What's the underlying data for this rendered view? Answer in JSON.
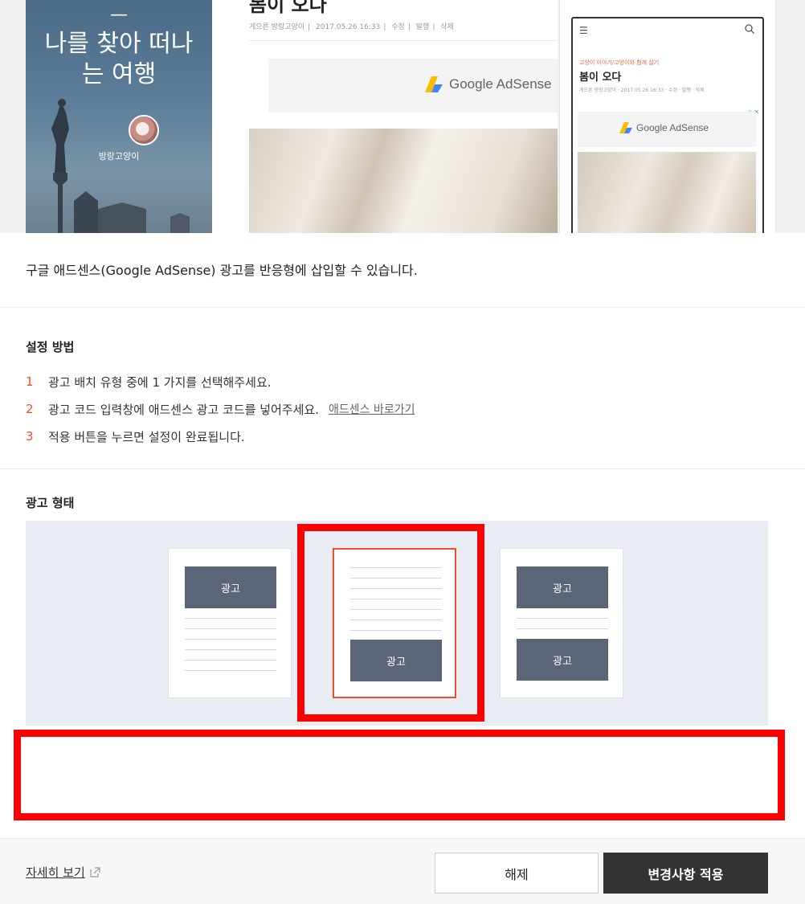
{
  "preview": {
    "cover_dash": "—",
    "cover_headline_line1": "나를 찾아 떠나",
    "cover_headline_line2": "는 여행",
    "cover_nickname": "방랑고양이",
    "article_title": "봄이 오다",
    "article_meta": [
      "게으른 방랑고양이",
      "2017.05.26 16:33",
      "수정",
      "발행",
      "삭제"
    ],
    "ad_brand": "Google AdSense",
    "mobile": {
      "category": "고양이 이야기/고양이와 함께 살기",
      "title": "봄이 오다",
      "meta": "게으른 방랑고양이 · 2017.05.26 16:33 · 수정 · 발행 · 삭제",
      "ad_brand": "Google AdSense"
    }
  },
  "description": "구글 애드센스(Google AdSense) 광고를 반응형에 삽입할 수 있습니다.",
  "setup": {
    "title": "설정 방법",
    "steps": [
      {
        "num": "1",
        "text": "광고 배치 유형 중에 1 가지를 선택해주세요."
      },
      {
        "num": "2",
        "text": "광고 코드 입력창에 애드센스 광고 코드를 넣어주세요.",
        "link": "애드센스 바로가기"
      },
      {
        "num": "3",
        "text": "적용 버튼을 누르면 설정이 완료됩니다."
      }
    ]
  },
  "ad_forms": {
    "title": "광고 형태",
    "ad_label": "광고",
    "options": [
      "top",
      "bottom",
      "top-and-bottom"
    ],
    "selected": "bottom"
  },
  "colors": {
    "accent": "#f04d2d",
    "ad_block": "#5a6577",
    "highlight": "#ff0000",
    "apply_button": "#333333"
  },
  "footer": {
    "more_link": "자세히 보기",
    "release_button": "해제",
    "apply_button": "변경사항 적용"
  }
}
